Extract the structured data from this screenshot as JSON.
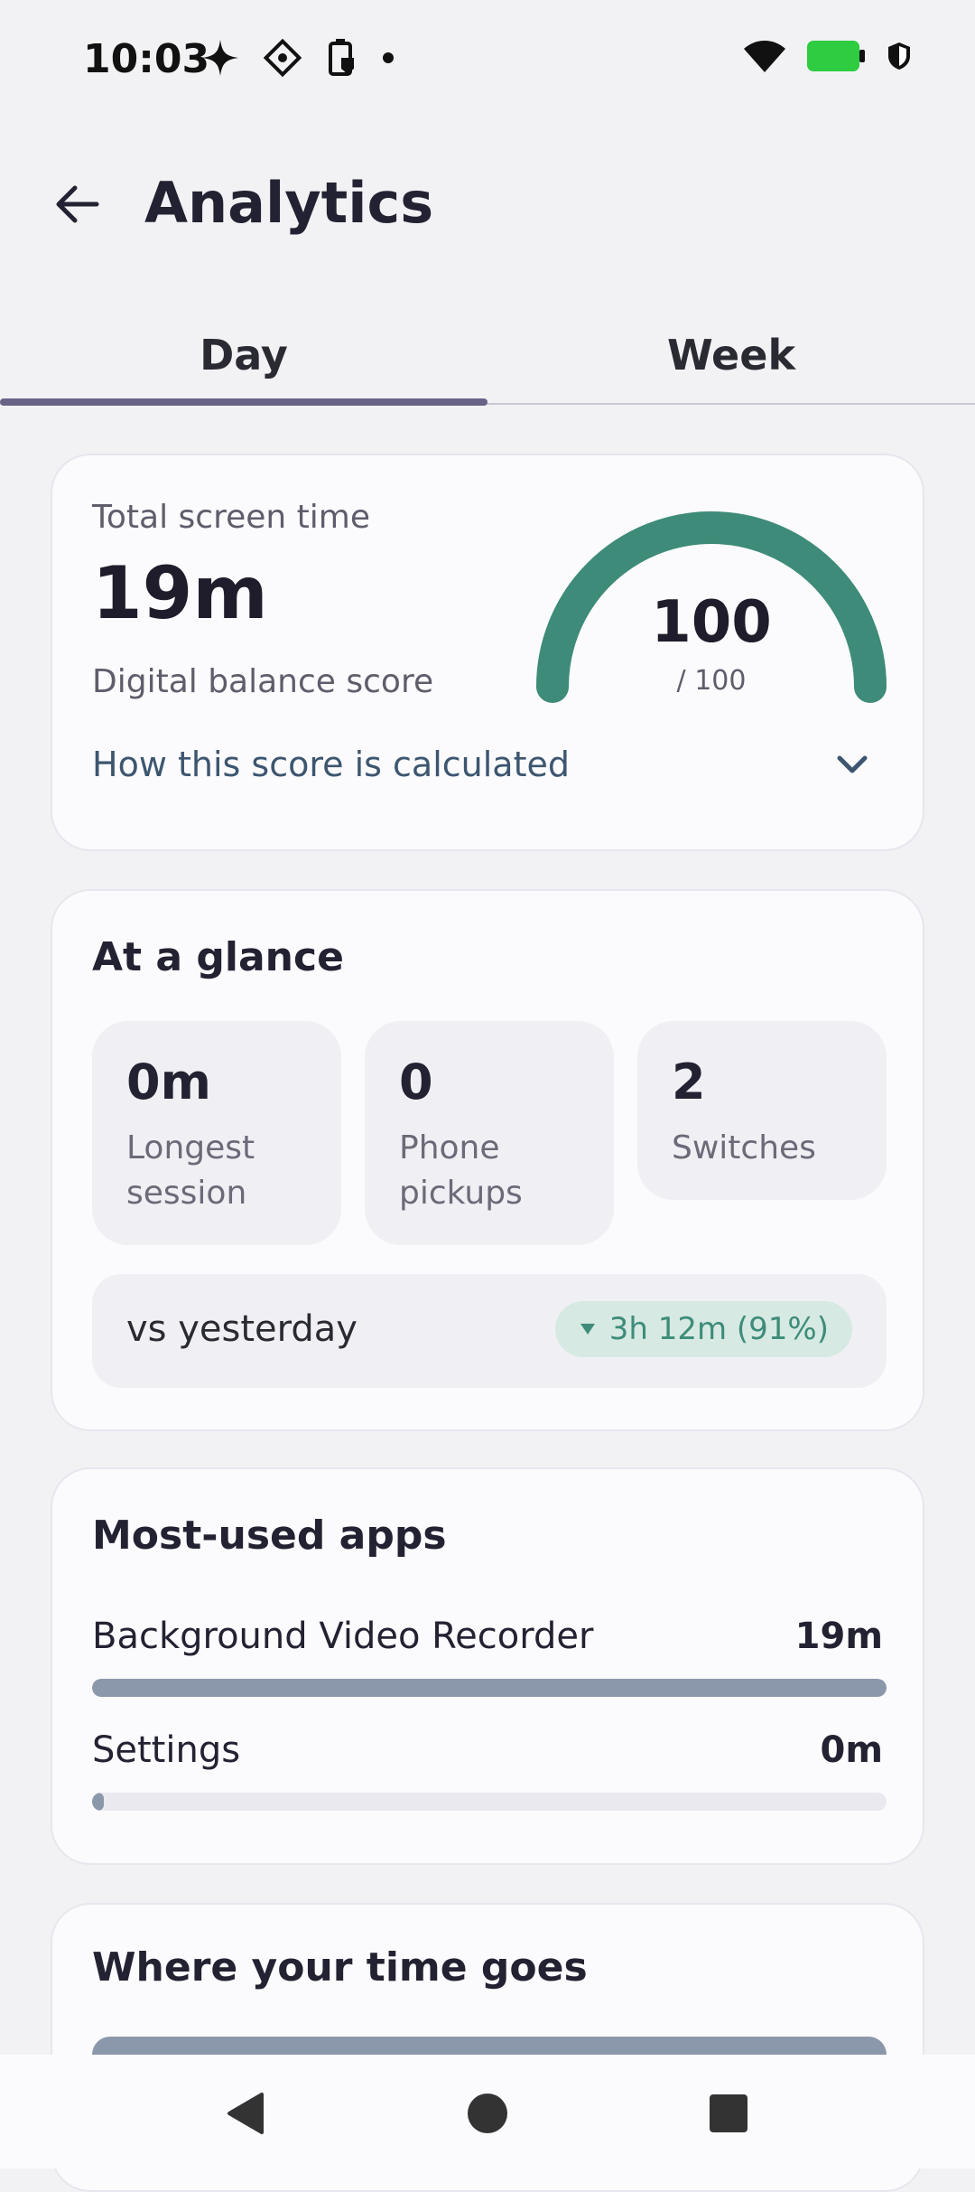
{
  "status_bar": {
    "time": "10:03",
    "left_icons": [
      "sparkle-icon",
      "app-diamond-icon",
      "battery-saver-icon",
      "dot-icon"
    ],
    "right_icons": [
      "wifi-icon",
      "battery-icon",
      "shield-icon"
    ],
    "battery_color": "#2ecc40"
  },
  "header": {
    "title": "Analytics",
    "back_icon": "arrow-left-icon"
  },
  "tabs": [
    {
      "label": "Day",
      "active": true
    },
    {
      "label": "Week",
      "active": false
    }
  ],
  "summary": {
    "total_label": "Total screen time",
    "total_value": "19m",
    "score_label": "Digital balance score",
    "score_value": "100",
    "score_max": "/ 100",
    "score_fraction": 1.0,
    "gauge_color": "#3d8b78",
    "link": "How this score is calculated"
  },
  "glance": {
    "title": "At a glance",
    "tiles": [
      {
        "value": "0m",
        "label": "Longest session"
      },
      {
        "value": "0",
        "label": "Phone pickups"
      },
      {
        "value": "2",
        "label": "Switches"
      }
    ],
    "vs_label": "vs yesterday",
    "vs_badge": "3h 12m (91%)",
    "vs_direction": "down"
  },
  "apps": {
    "title": "Most-used apps",
    "items": [
      {
        "name": "Background Video Recorder",
        "time": "19m",
        "fraction": 1.0
      },
      {
        "name": "Settings",
        "time": "0m",
        "fraction": 0.015
      }
    ]
  },
  "time_goes": {
    "title": "Where your time goes"
  },
  "nav": [
    "back-triangle-icon",
    "home-circle-icon",
    "recents-square-icon"
  ]
}
